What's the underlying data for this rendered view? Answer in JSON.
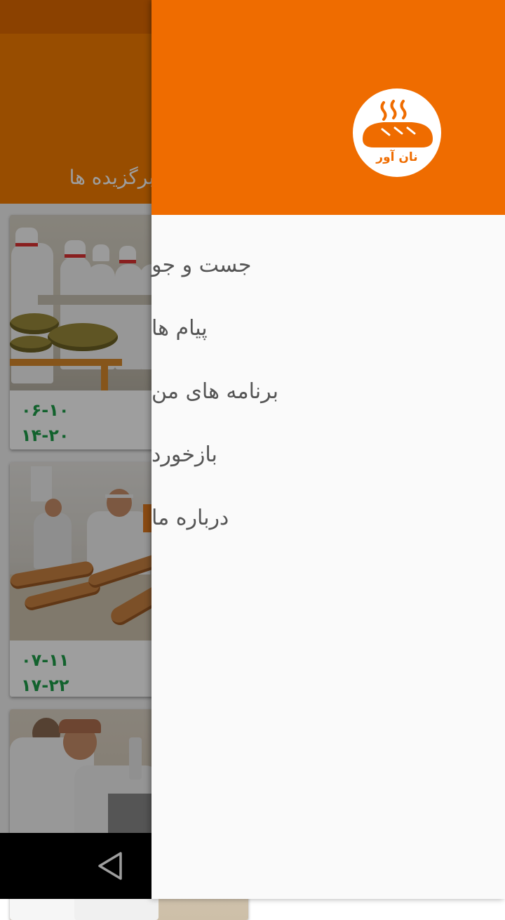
{
  "app": {
    "name": "نان آور",
    "appbar_title": "برگزیده ها"
  },
  "bakeries": [
    {
      "hours_1": "۰۶-۱۰",
      "hours_2": "۱۴-۲۰"
    },
    {
      "hours_1": "۰۷-۱۱",
      "hours_2": "۱۷-۲۲"
    },
    {
      "hours_1": "",
      "hours_2": ""
    }
  ],
  "drawer": {
    "items": [
      {
        "label": "جست و جو"
      },
      {
        "label": "پیام ها"
      },
      {
        "label": "برنامه های من"
      },
      {
        "label": "بازخورد"
      },
      {
        "label": "درباره ما"
      }
    ]
  },
  "colors": {
    "primary": "#f57c00",
    "primary_dark": "#e06a00",
    "drawer_header": "#ef6c00",
    "hours_text": "#1e9e4a",
    "menu_text": "#555555"
  },
  "icons": {
    "logo": "bread-icon",
    "nav_back": "back-triangle-icon"
  }
}
